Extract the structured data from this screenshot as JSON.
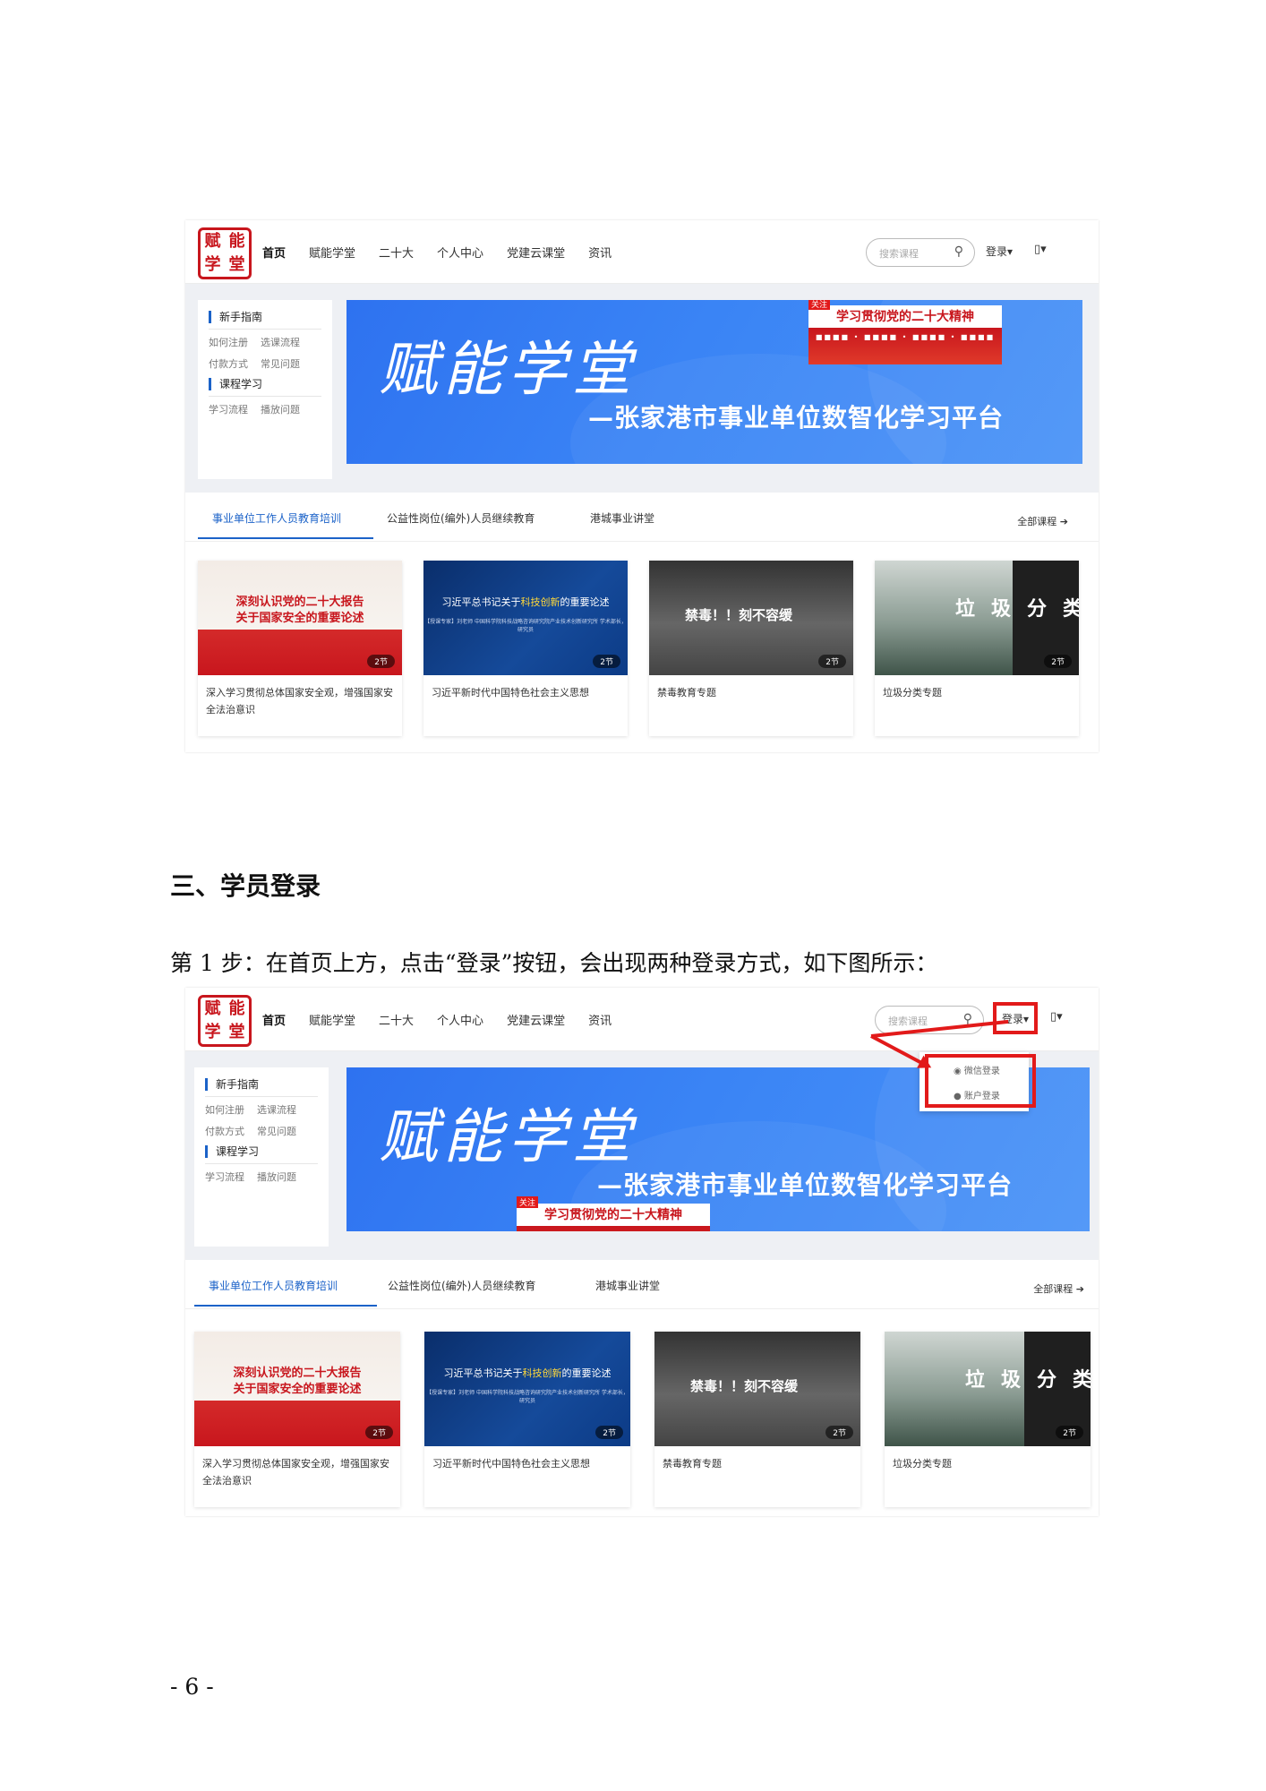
{
  "site": {
    "logo_chars": [
      "赋",
      "能",
      "学",
      "堂"
    ],
    "menu": [
      "首页",
      "赋能学堂",
      "二十大",
      "个人中心",
      "党建云课堂",
      "资讯"
    ],
    "search_placeholder": "搜索课程",
    "search_icon": "search-icon",
    "login_label": "登录▾",
    "mobile_label": "▯▾",
    "guide": {
      "heading1": "新手指南",
      "row1": [
        "如何注册",
        "选课流程"
      ],
      "row2": [
        "付款方式",
        "常见问题"
      ],
      "heading2": "课程学习",
      "row3": [
        "学习流程",
        "播放问题"
      ]
    },
    "banner": {
      "title": "赋能学堂",
      "subtitle": "—张家港市事业单位数智化学习平台",
      "ribbon_tag": "关注",
      "ribbon_title": "学习贯彻党的二十大精神",
      "ribbon_sub": "■■■■ • ■■■■ • ■■■■ • ■■■■"
    },
    "tabs": [
      "事业单位工作人员教育培训",
      "公益性岗位(编外)人员继续教育",
      "港城事业讲堂"
    ],
    "all_courses": "全部课程 ➔",
    "cards": [
      {
        "thumb_title_1": "深刻认识党的二十大报告",
        "thumb_title_2": "关于国家安全的重要论述",
        "badge": "2节",
        "title": "深入学习贯彻总体国家安全观，增强国家安全法治意识"
      },
      {
        "thumb_title_1": "习近平总书记关于",
        "thumb_highlight": "科技创新",
        "thumb_title_2": "的重要论述",
        "thumb_sub": "【授课专家】刘老师 中国科学院科技战略咨询研究院产业技术创新研究所 学术部长，研究员",
        "badge": "2节",
        "title": "习近平新时代中国特色社会主义思想"
      },
      {
        "thumb_title_1": "禁毒！！刻不容缓",
        "badge": "2节",
        "title": "禁毒教育专题"
      },
      {
        "thumb_title_1": "垃圾分类",
        "badge": "2节",
        "title": "垃圾分类专题"
      }
    ],
    "dropdown": [
      "微信登录",
      "账户登录"
    ]
  },
  "document": {
    "heading": "三、学员登录",
    "step1": "第 1 步：在首页上方，点击“登录”按钮，会出现两种登录方式，如下图所示：",
    "page_number": "- 6 -"
  },
  "colors": {
    "brand_red": "#c8161d",
    "accent_blue": "#1b62c8",
    "highlight_red": "#e21a1a"
  }
}
